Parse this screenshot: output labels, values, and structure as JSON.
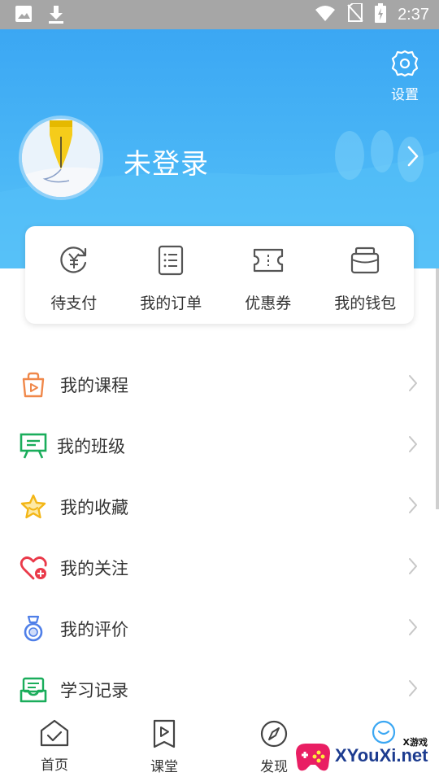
{
  "status_bar": {
    "time": "2:37",
    "left_icons": [
      "image-icon",
      "download-icon"
    ],
    "right_icons": [
      "wifi-icon",
      "no-sim-icon",
      "battery-charging-icon"
    ]
  },
  "header": {
    "settings_label": "设置",
    "username": "未登录"
  },
  "quick_actions": [
    {
      "label": "待支付",
      "icon": "yen-refresh-icon"
    },
    {
      "label": "我的订单",
      "icon": "order-list-icon"
    },
    {
      "label": "优惠券",
      "icon": "coupon-icon"
    },
    {
      "label": "我的钱包",
      "icon": "wallet-icon"
    }
  ],
  "menu": [
    {
      "label": "我的课程",
      "icon": "course-bag-icon",
      "color": "#f0884a"
    },
    {
      "label": "我的班级",
      "icon": "class-board-icon",
      "color": "#1aad5b"
    },
    {
      "label": "我的收藏",
      "icon": "star-icon",
      "color": "#f3b617"
    },
    {
      "label": "我的关注",
      "icon": "heart-plus-icon",
      "color": "#ea3a4a"
    },
    {
      "label": "我的评价",
      "icon": "medal-icon",
      "color": "#4f7fe8"
    },
    {
      "label": "学习记录",
      "icon": "record-tray-icon",
      "color": "#1aad5b"
    }
  ],
  "bottom_nav": [
    {
      "label": "首页",
      "icon": "home-icon"
    },
    {
      "label": "课堂",
      "icon": "classroom-play-icon"
    },
    {
      "label": "发现",
      "icon": "compass-icon"
    },
    {
      "label": "",
      "icon": "profile-icon"
    }
  ],
  "watermark": {
    "text": "XYouXi.net",
    "small": "X游戏"
  }
}
